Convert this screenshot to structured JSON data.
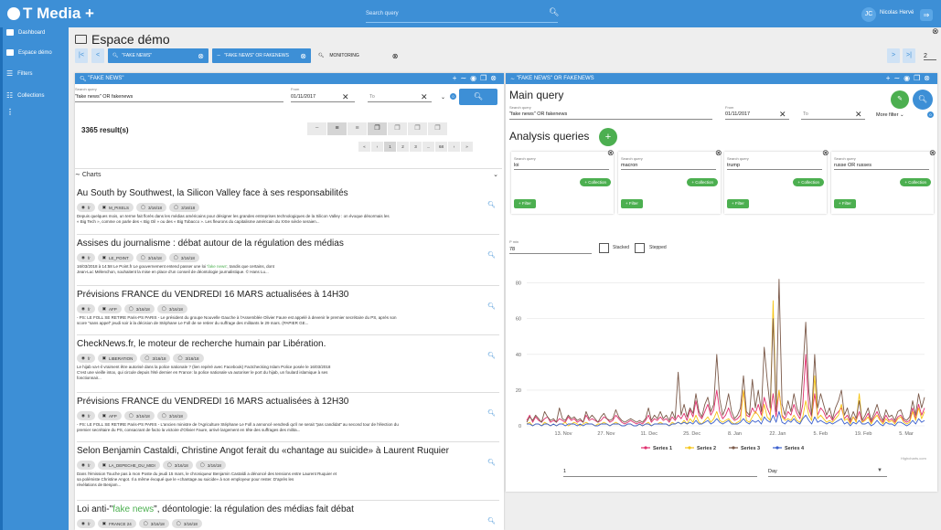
{
  "app": {
    "logo": "T Media +",
    "search_placeholder": "Search query",
    "user_initials": "JC",
    "user_name": "Nicolas Hervé"
  },
  "sidebar": {
    "items": [
      {
        "label": "Dashboard"
      },
      {
        "label": "Espace démo"
      },
      {
        "label": "Filters"
      },
      {
        "label": "Collections"
      }
    ]
  },
  "page": {
    "title": "Espace démo"
  },
  "tabs": {
    "prev": "|<",
    "back": "<",
    "next": ">",
    "last": ">|",
    "page": "2",
    "items": [
      {
        "label": "\"FAKE NEWS\""
      },
      {
        "label": "\"FAKE NEWS\" OR FAKENEWS"
      },
      {
        "label": "MONITORING"
      }
    ]
  },
  "left_panel": {
    "title": "\"FAKE NEWS\"",
    "query_label": "Search query",
    "query": "\"fake news\" OR fakenews",
    "from_label": "From",
    "from": "01/11/2017",
    "to_placeholder": "To",
    "results": "3365 result(s)",
    "pager": [
      "«",
      "‹",
      "1",
      "2",
      "3",
      "...",
      "68",
      "›",
      "»"
    ],
    "charts_label": "Charts"
  },
  "articles": [
    {
      "title": "Au South by Southwest, la Silicon Valley face à ses responsabilités",
      "lang": "fr",
      "source": "M_PIXELS",
      "date1": "3/16/18",
      "date2": "3/16/18",
      "text1": "Depuis quelques mois, un terme fait florès dans les médias américains pour désigner les grandes entreprises technologiques de la Silicon Valley : on évoque désormais les",
      "text2": "« Big Tech », comme on parle des « Big Oil » ou des « Big Tobacco ». Les fleurons du capitalisme américain du XXIe siècle seraien..."
    },
    {
      "title": "Assises du journalisme : débat autour de la régulation des médias",
      "lang": "fr",
      "source": "LE_POINT",
      "date1": "3/16/18",
      "date2": "3/16/18",
      "text1a": "16/03/2018 à 14:58 Le Point.fr Le gouvernement entend passer une loi ",
      "text1hl": "'fake  news'",
      "text1b": ", tandis que certains, dont",
      "text2": "Jean-Luc Mélenchon, souhaitent la mise en place d'un conseil de déontologie journalistique. © Hans Lu..."
    },
    {
      "title": "Prévisions FRANCE du VENDREDI 16 MARS actualisées à 14H30",
      "lang": "fr",
      "source": "AFP",
      "date1": "3/16/18",
      "date2": "3/16/18",
      "text1": "- PS: LE FOLL SE RETIRE Paris-PS PARIS - Le président du groupe Nouvelle Gauche à l'Assemblée Olivier Faure est appelé à devenir le premier secrétaire du PS, après son",
      "text2": "score \"sans appel\" jeudi soir à la décision de Stéphane Le Foll de se retirer du suffrage des militants le 29 mars. (PAPIER GE..."
    },
    {
      "title": "CheckNews.fr, le moteur de recherche humain par Libération.",
      "lang": "fr",
      "source": "LIBERATION",
      "date1": "3/16/18",
      "date2": "3/16/18",
      "text1": "Le hijab va-t-il vraiment être autorisé dans la police nationale ? (lien repéré avec Facebook) Factchecking Islam Police posée le 16/03/2018",
      "text2": "C'est une vieille intox, qui circule depuis l'été dernier en France: la police nationale va autoriser le port du hijab, un foulard islamique à ses",
      "text3": "fonctionnair..."
    },
    {
      "title": "Prévisions FRANCE du VENDREDI 16 MARS actualisées à 12H30",
      "lang": "fr",
      "source": "AFP",
      "date1": "3/16/18",
      "date2": "3/16/18",
      "text1": "- PS: LE FOLL SE RETIRE Paris-PS PARIS - L'ancien ministre de l'Agriculture Stéphane Le Foll a annoncé vendredi qu'il ne serait \"pas candidat\" au second tour de l'élection du",
      "text2": "premier secrétaire du PS, consacrant de facto la victoire d'Olivier Faure, arrivé largement en tête des suffrages des milita..."
    },
    {
      "title": "Selon Benjamin Castaldi, Christine Angot ferait du «chantage au suicide» à Laurent Ruquier",
      "lang": "fr",
      "source": "LA_DEPECHE_DU_MIDI",
      "date1": "3/16/18",
      "date2": "3/16/18",
      "text1": "Dans l'émission Touche pas à mon Poste du jeudi 15 mars, le chroniqueur Benjamin Castaldi a dénoncé des tensions entre Laurent Ruquier et",
      "text2": "sa polémiste Christine Angot. Il a même évoqué que le «chantage au suicide» à son employeur pour rester. D'après les",
      "text3": "révélations de Benjam..."
    },
    {
      "title_a": "Loi anti-\"",
      "title_hl": "fake  news",
      "title_b": "\", déontologie: la régulation des médias fait débat",
      "lang": "fr",
      "source": "FRANCE 24",
      "date1": "3/16/18",
      "date2": "3/16/18"
    }
  ],
  "right_panel": {
    "title": "\"FAKE NEWS\" OR FAKENEWS",
    "main_query": "Main query",
    "query_label": "Search query",
    "query": "\"fake news\" OR fakenews",
    "from_label": "From",
    "from": "01/11/2017",
    "to_placeholder": "To",
    "more_filter": "More filter",
    "analysis": "Analysis queries",
    "queries": [
      {
        "label": "Search query",
        "value": "loi"
      },
      {
        "label": "Search query",
        "value": "macron"
      },
      {
        "label": "Search query",
        "value": "trump"
      },
      {
        "label": "Search query",
        "value": "russe OR russes"
      }
    ],
    "collection_btn": "+ Collection",
    "filter_btn": "+ Filter",
    "pmin_label": "P min",
    "pmin": "78",
    "stacked": "Stacked",
    "stepped": "Stepped",
    "bottom_value": "1",
    "bottom_unit": "Day",
    "credit": "Highcharts.com"
  },
  "colors": {
    "primary": "#3d8fd6",
    "green": "#4caf50",
    "s1": "#e0306e",
    "s2": "#f5c518",
    "s3": "#7b5a4a",
    "s4": "#3a5fcd"
  },
  "chart_data": {
    "type": "line",
    "xlabel": "",
    "ylabel": "",
    "ylim": [
      0,
      90
    ],
    "yticks": [
      0,
      20,
      40,
      60,
      80
    ],
    "x_start": "2017-11-01",
    "x_end": "2018-03-16",
    "xticks": [
      "13. Nov",
      "27. Nov",
      "11. Dec",
      "25. Dec",
      "8. Jan",
      "22. Jan",
      "5. Feb",
      "19. Feb",
      "5. Mar"
    ],
    "series": [
      {
        "name": "Series 1",
        "values": [
          3,
          6,
          2,
          5,
          3,
          2,
          4,
          5,
          2,
          3,
          2,
          4,
          3,
          2,
          5,
          3,
          4,
          2,
          3,
          2,
          6,
          3,
          4,
          3,
          2,
          3,
          5,
          4,
          2,
          3,
          6,
          4,
          2,
          1,
          2,
          3,
          2,
          1,
          2,
          1,
          3,
          6,
          2,
          4,
          3,
          5,
          3,
          4,
          2,
          5,
          3,
          6,
          4,
          7,
          3,
          9,
          5,
          14,
          6,
          4,
          8,
          12,
          6,
          9,
          20,
          8,
          4,
          6,
          10,
          5,
          3,
          4,
          6,
          20,
          6,
          5,
          10,
          7,
          12,
          6,
          16,
          10,
          6,
          18,
          5,
          20,
          6,
          4,
          8,
          6,
          12,
          7,
          4,
          12,
          40,
          10,
          5,
          18,
          6,
          10,
          8,
          4,
          6,
          3,
          6,
          8,
          10,
          4,
          6,
          2,
          5,
          3,
          8,
          2,
          4,
          7,
          2,
          5,
          8,
          4,
          2,
          6,
          3,
          4,
          2,
          5,
          6,
          3,
          2,
          3,
          10,
          4,
          12,
          6,
          10
        ]
      },
      {
        "name": "Series 2",
        "values": [
          1,
          2,
          0,
          1,
          1,
          0,
          2,
          1,
          0,
          1,
          0,
          1,
          1,
          2,
          0,
          1,
          2,
          1,
          0,
          1,
          2,
          1,
          1,
          0,
          1,
          1,
          2,
          1,
          0,
          1,
          2,
          1,
          0,
          0,
          1,
          1,
          0,
          0,
          1,
          0,
          1,
          2,
          0,
          1,
          1,
          2,
          1,
          1,
          0,
          2,
          1,
          2,
          1,
          3,
          1,
          4,
          2,
          6,
          2,
          1,
          3,
          5,
          2,
          4,
          8,
          3,
          2,
          3,
          4,
          2,
          1,
          2,
          3,
          20,
          3,
          2,
          5,
          8,
          6,
          3,
          12,
          5,
          3,
          70,
          10,
          20,
          5,
          3,
          4,
          3,
          6,
          3,
          2,
          5,
          14,
          6,
          3,
          28,
          4,
          6,
          4,
          2,
          3,
          2,
          4,
          6,
          12,
          3,
          4,
          1,
          5,
          2,
          18,
          2,
          3,
          5,
          1,
          4,
          6,
          3,
          1,
          4,
          2,
          3,
          1,
          4,
          5,
          2,
          1,
          2,
          8,
          3,
          10,
          4,
          8
        ]
      },
      {
        "name": "Series 3",
        "values": [
          2,
          5,
          3,
          6,
          4,
          2,
          8,
          5,
          3,
          4,
          2,
          10,
          4,
          3,
          6,
          4,
          5,
          3,
          4,
          2,
          8,
          4,
          6,
          4,
          2,
          5,
          7,
          4,
          3,
          4,
          9,
          5,
          3,
          2,
          3,
          4,
          3,
          2,
          3,
          2,
          4,
          10,
          3,
          6,
          4,
          8,
          4,
          6,
          3,
          8,
          4,
          30,
          6,
          12,
          5,
          10,
          7,
          18,
          8,
          5,
          12,
          16,
          8,
          12,
          40,
          15,
          6,
          10,
          18,
          8,
          4,
          6,
          10,
          28,
          8,
          6,
          26,
          10,
          20,
          8,
          44,
          26,
          10,
          60,
          8,
          82,
          12,
          6,
          14,
          8,
          18,
          10,
          6,
          30,
          58,
          20,
          6,
          40,
          10,
          18,
          12,
          6,
          10,
          4,
          10,
          14,
          20,
          6,
          10,
          3,
          8,
          4,
          14,
          3,
          6,
          10,
          3,
          7,
          12,
          6,
          3,
          9,
          5,
          6,
          3,
          8,
          9,
          4,
          3,
          5,
          14,
          6,
          18,
          10,
          16
        ]
      },
      {
        "name": "Series 4",
        "values": [
          1,
          1,
          0,
          1,
          1,
          0,
          1,
          1,
          0,
          1,
          0,
          1,
          1,
          0,
          1,
          1,
          1,
          0,
          1,
          0,
          1,
          1,
          1,
          0,
          0,
          1,
          1,
          1,
          0,
          1,
          1,
          1,
          0,
          0,
          1,
          1,
          0,
          0,
          1,
          0,
          1,
          1,
          0,
          1,
          1,
          1,
          1,
          1,
          0,
          1,
          1,
          2,
          1,
          2,
          1,
          2,
          1,
          3,
          1,
          1,
          2,
          3,
          1,
          2,
          4,
          2,
          1,
          2,
          3,
          1,
          1,
          1,
          2,
          4,
          2,
          1,
          3,
          2,
          3,
          1,
          5,
          3,
          2,
          6,
          2,
          8,
          2,
          1,
          3,
          2,
          4,
          2,
          1,
          4,
          6,
          3,
          1,
          5,
          2,
          3,
          2,
          1,
          2,
          1,
          2,
          3,
          4,
          1,
          2,
          0,
          2,
          1,
          3,
          1,
          1,
          2,
          0,
          1,
          3,
          1,
          0,
          2,
          1,
          1,
          0,
          2,
          2,
          1,
          0,
          1,
          3,
          1,
          4,
          2,
          3
        ]
      }
    ]
  }
}
